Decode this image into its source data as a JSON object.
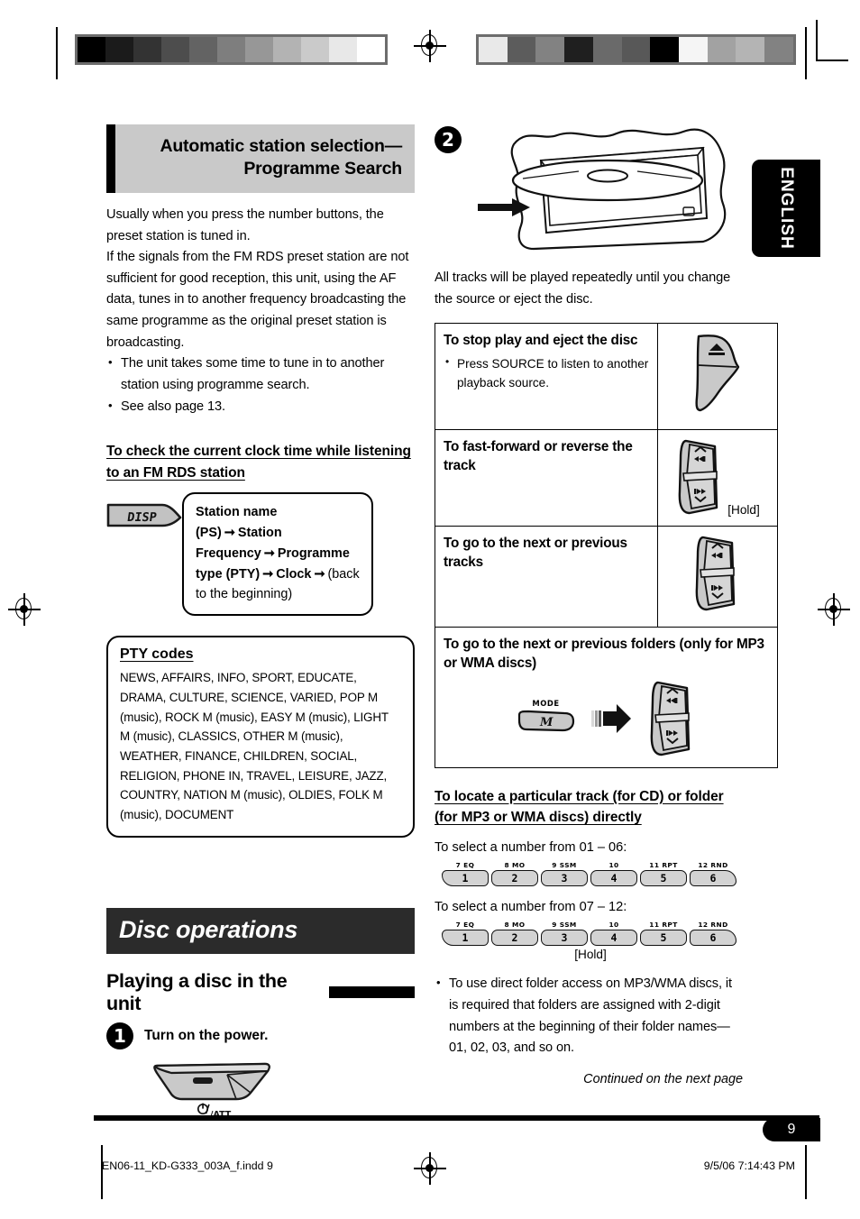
{
  "page": {
    "number": "9",
    "language_tab": "ENGLISH",
    "footer_left": "EN06-11_KD-G333_003A_f.indd   9",
    "footer_right": "9/5/06   7:14:43 PM",
    "continued": "Continued on the next page"
  },
  "left": {
    "band_title_line1": "Automatic station selection—",
    "band_title_line2": "Programme Search",
    "intro": "Usually when you press the number buttons, the preset station is tuned in.\nIf the signals from the FM RDS preset station are not sufficient for good reception, this unit, using the AF data, tunes in to another frequency broadcasting the same programme as the original preset station is broadcasting.",
    "bullets": [
      "The unit takes some time to tune in to another station using programme search.",
      "See also page 13."
    ],
    "clock_heading": "To check the current clock time while listening to an FM RDS station",
    "disp_button_label": "DISP",
    "disp_sequence": {
      "p1": "Station name (PS)",
      "p2": "Station Frequency",
      "p3": "Programme type (PTY)",
      "p4": "Clock",
      "tail": "(back to the beginning)",
      "arrow": "➞"
    },
    "pty": {
      "title": "PTY codes",
      "codes": "NEWS, AFFAIRS, INFO, SPORT, EDUCATE, DRAMA, CULTURE, SCIENCE, VARIED, POP M (music), ROCK M (music), EASY M (music), LIGHT M (music), CLASSICS, OTHER M (music), WEATHER, FINANCE, CHILDREN, SOCIAL, RELIGION, PHONE IN, TRAVEL, LEISURE, JAZZ, COUNTRY, NATION M (music), OLDIES, FOLK M (music), DOCUMENT"
    },
    "section_title": "Disc operations",
    "sub_title": "Playing a disc in the unit",
    "step1": {
      "number": "1",
      "text": "Turn on the power.",
      "button_label": "/ATT"
    }
  },
  "right": {
    "step2": {
      "number": "2",
      "caption": "All tracks will be played repeatedly until you change the source or eject the disc."
    },
    "ops_table": [
      {
        "title": "To stop play and eject the disc",
        "bullets": [
          "Press SOURCE to listen to another playback source."
        ],
        "icon": "eject-button-icon",
        "hold": ""
      },
      {
        "title": "To fast-forward or reverse the track",
        "bullets": [],
        "icon": "track-rocker-icon",
        "hold": "[Hold]"
      },
      {
        "title": "To go to the next or previous tracks",
        "bullets": [],
        "icon": "track-rocker-icon",
        "hold": ""
      }
    ],
    "folders_row": {
      "title": "To go to the next or previous folders (only for MP3 or WMA discs)",
      "mode_caption": "MODE",
      "mode_key": "M"
    },
    "locate_heading": "To locate a particular track (for CD) or folder (for MP3 or WMA discs) directly",
    "select_01_06": "To select a number from 01 – 06:",
    "select_07_12": "To select a number from 07 – 12:",
    "hold_label": "[Hold]",
    "number_buttons": [
      {
        "caption": "7  EQ",
        "key": "1"
      },
      {
        "caption": "8  MO",
        "key": "2"
      },
      {
        "caption": "9  SSM",
        "key": "3"
      },
      {
        "caption": "10",
        "key": "4"
      },
      {
        "caption": "11  RPT",
        "key": "5"
      },
      {
        "caption": "12  RND",
        "key": "6"
      }
    ],
    "note_bullet": "To use direct folder access on MP3/WMA discs, it is required that folders are assigned with 2-digit numbers at the beginning of their folder names—01, 02, 03, and so on."
  },
  "calibration": {
    "left_bar": [
      "#000000",
      "#1b1b1b",
      "#333333",
      "#4d4d4d",
      "#636363",
      "#7e7e7e",
      "#979797",
      "#b3b3b3",
      "#cacaca",
      "#e8e8e8",
      "#ffffff"
    ],
    "right_bar": [
      "#e9e9e9",
      "#5c5c5c",
      "#828282",
      "#1f1f1f",
      "#6a6a6a",
      "#585858",
      "#000000",
      "#f5f5f5",
      "#a2a2a2",
      "#b4b4b4",
      "#828282"
    ]
  }
}
